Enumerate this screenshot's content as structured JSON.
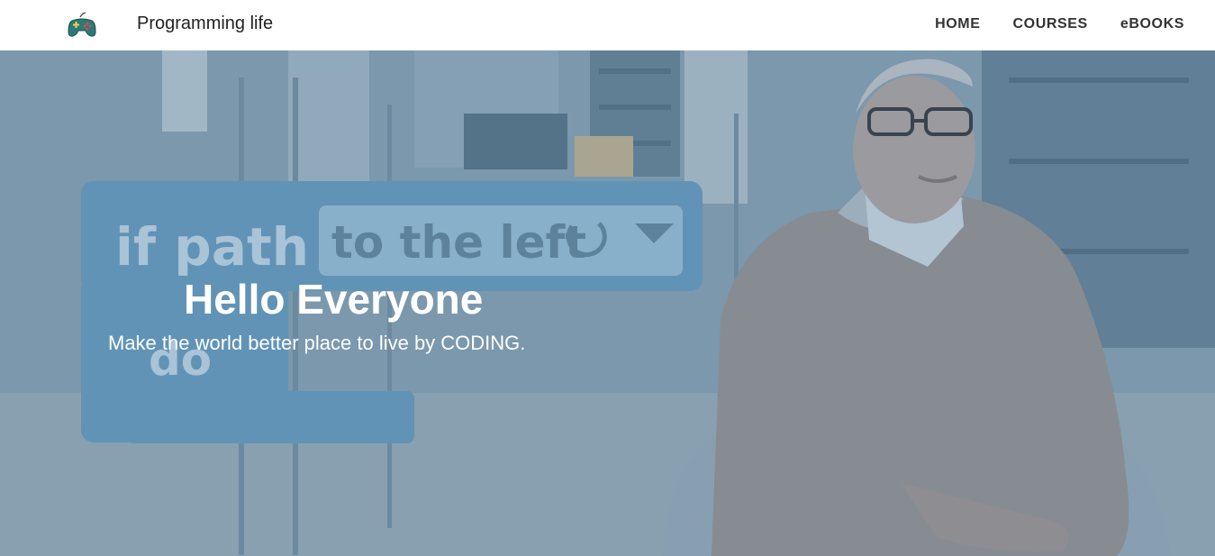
{
  "navbar": {
    "logo_icon": "gamepad-icon",
    "brand": "Programming life",
    "links": [
      "HOME",
      "COURSES",
      "eBOOKS"
    ]
  },
  "hero": {
    "background_text": {
      "block_label": "if path",
      "dropdown_label": "to the left",
      "do_label": "do"
    },
    "title": "Hello Everyone",
    "subtitle": "Make the world better place to live by CODING."
  },
  "colors": {
    "overlay": "#6f96b4",
    "nav_text": "#333333",
    "brand_text": "#222222",
    "hero_text": "#ffffff"
  }
}
